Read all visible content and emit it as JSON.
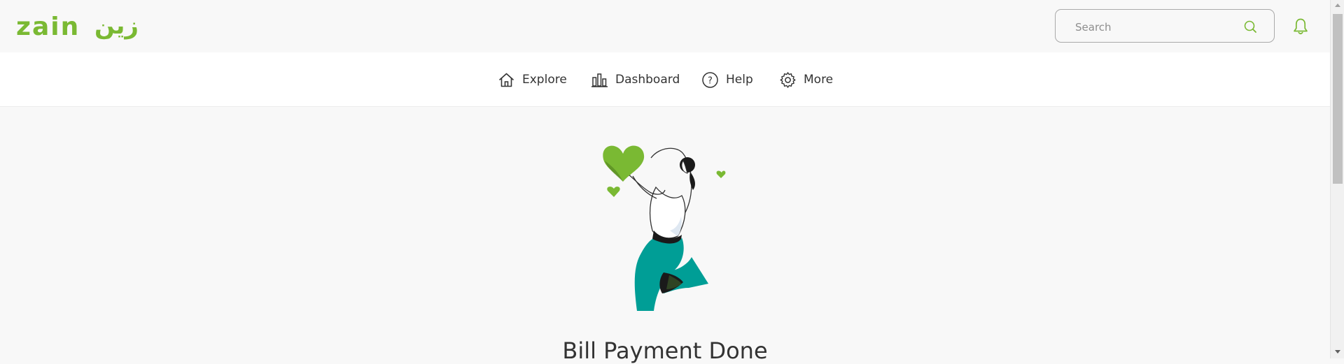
{
  "brand": {
    "name": "zain",
    "arabic_name": "زين",
    "color": "#7ab933"
  },
  "search": {
    "placeholder": "Search",
    "value": ""
  },
  "icons": {
    "search": "search-icon",
    "notifications": "bell-icon",
    "explore": "home-icon",
    "dashboard": "bar-chart-icon",
    "help": "question-circle-icon",
    "more": "gear-icon"
  },
  "nav": {
    "items": [
      {
        "label": "Explore",
        "icon": "home-icon"
      },
      {
        "label": "Dashboard",
        "icon": "bar-chart-icon"
      },
      {
        "label": "Help",
        "icon": "question-circle-icon"
      },
      {
        "label": "More",
        "icon": "gear-icon"
      }
    ]
  },
  "main": {
    "title": "Bill Payment Done"
  },
  "colors": {
    "accent": "#7ab933",
    "teal": "#009e96",
    "background": "#f8f8f8"
  }
}
